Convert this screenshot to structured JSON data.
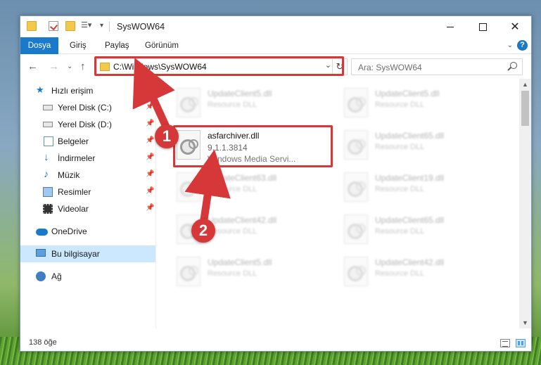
{
  "window": {
    "title": "SysWOW64"
  },
  "ribbon": {
    "tabs": [
      "Dosya",
      "Giriş",
      "Paylaş",
      "Görünüm"
    ],
    "help": "?"
  },
  "nav": {
    "address_path": "C:\\Windows\\SysWOW64",
    "search_placeholder": "Ara: SysWOW64"
  },
  "sidebar": {
    "items": [
      {
        "label": "Hızlı erişim",
        "icon": "star-icon",
        "pinned": false
      },
      {
        "label": "Yerel Disk (C:)",
        "icon": "disk-icon",
        "pinned": true
      },
      {
        "label": "Yerel Disk (D:)",
        "icon": "disk-icon",
        "pinned": true
      },
      {
        "label": "Belgeler",
        "icon": "documents-icon",
        "pinned": true
      },
      {
        "label": "İndirmeler",
        "icon": "download-icon",
        "pinned": true
      },
      {
        "label": "Müzik",
        "icon": "music-icon",
        "pinned": true
      },
      {
        "label": "Resimler",
        "icon": "pictures-icon",
        "pinned": true
      },
      {
        "label": "Videolar",
        "icon": "videos-icon",
        "pinned": true
      },
      {
        "label": "OneDrive",
        "icon": "cloud-icon",
        "pinned": false
      },
      {
        "label": "Bu bilgisayar",
        "icon": "computer-icon",
        "pinned": false,
        "selected": true
      },
      {
        "label": "Ağ",
        "icon": "network-icon",
        "pinned": false
      }
    ]
  },
  "files": {
    "highlighted": {
      "name": "asfarchiver.dll",
      "version": "9.1.1.3814",
      "description": "Windows Media Servi..."
    },
    "left_column": [
      {
        "name": "UpdateClient5.dll",
        "desc": "Resource DLL"
      },
      {
        "name": "UpdateClient63.dll",
        "desc": "Resource DLL"
      },
      {
        "name": "UpdateClient42.dll",
        "desc": "Resource DLL"
      },
      {
        "name": "UpdateClient5.dll",
        "desc": "Resource DLL"
      }
    ],
    "right_column": [
      {
        "name": "UpdateClient5.dll",
        "desc": "Resource DLL"
      },
      {
        "name": "UpdateClient65.dll",
        "desc": "Resource DLL"
      },
      {
        "name": "UpdateClient19.dll",
        "desc": "Resource DLL"
      },
      {
        "name": "UpdateClient65.dll",
        "desc": "Resource DLL"
      },
      {
        "name": "UpdateClient42.dll",
        "desc": "Resource DLL"
      }
    ]
  },
  "status": {
    "item_count": "138 öğe"
  },
  "annotations": {
    "step1": "1",
    "step2": "2",
    "color": "#d6383a"
  }
}
